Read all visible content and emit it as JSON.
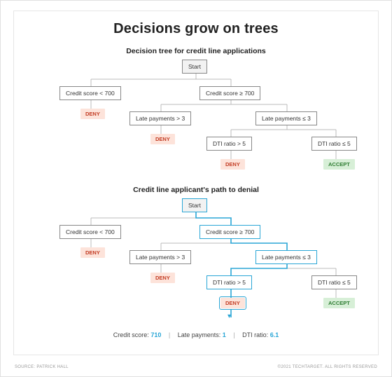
{
  "title": "Decisions grow on trees",
  "tree1": {
    "subtitle": "Decision tree for credit line applications",
    "start": "Start",
    "cs_lt": "Credit score < 700",
    "cs_ge": "Credit score ≥ 700",
    "lp_gt": "Late payments > 3",
    "lp_le": "Late payments ≤ 3",
    "dti_gt": "DTI ratio > 5",
    "dti_le": "DTI ratio ≤ 5",
    "deny": "DENY",
    "accept": "ACCEPT"
  },
  "tree2": {
    "subtitle": "Credit line applicant's path to denial",
    "start": "Start",
    "cs_lt": "Credit score < 700",
    "cs_ge": "Credit score ≥ 700",
    "lp_gt": "Late payments > 3",
    "lp_le": "Late payments ≤ 3",
    "dti_gt": "DTI ratio > 5",
    "dti_le": "DTI ratio ≤ 5",
    "deny": "DENY",
    "accept": "ACCEPT"
  },
  "summary": {
    "cs_label": "Credit score:",
    "cs_val": "710",
    "lp_label": "Late payments:",
    "lp_val": "1",
    "dti_label": "DTI ratio:",
    "dti_val": "6.1"
  },
  "footer": {
    "left": "SOURCE: PATRICK HALL",
    "right": "©2021 TECHTARGET. ALL RIGHTS RESERVED"
  }
}
